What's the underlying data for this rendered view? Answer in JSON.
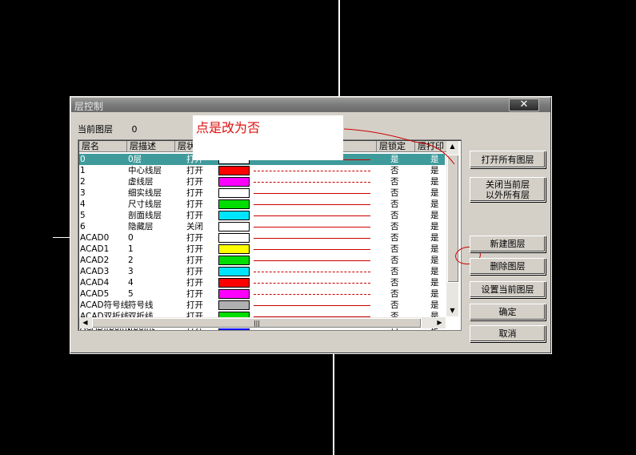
{
  "dialog": {
    "title": "层控制",
    "close_label": "✕",
    "current_layer_label": "当前图层",
    "current_layer_value": "0",
    "annotation": "点是改为否"
  },
  "columns": [
    "层名",
    "层描述",
    "层状",
    "层锁定",
    "层打印"
  ],
  "rows": [
    {
      "name": "0",
      "desc": "0层",
      "state": "打开",
      "color": "#ffffff",
      "line": "solid",
      "locked": "是",
      "print": "是",
      "selected": true
    },
    {
      "name": "1",
      "desc": "中心线层",
      "state": "打开",
      "color": "#ff0000",
      "line": "dashdot",
      "locked": "否",
      "print": "是"
    },
    {
      "name": "2",
      "desc": "虚线层",
      "state": "打开",
      "color": "#ff00ff",
      "line": "dash",
      "locked": "否",
      "print": "是"
    },
    {
      "name": "3",
      "desc": "细实线层",
      "state": "打开",
      "color": "#ffffff",
      "line": "solid",
      "locked": "否",
      "print": "是"
    },
    {
      "name": "4",
      "desc": "尺寸线层",
      "state": "打开",
      "color": "#00dd00",
      "line": "solid",
      "locked": "否",
      "print": "是"
    },
    {
      "name": "5",
      "desc": "剖面线层",
      "state": "打开",
      "color": "#00e5ff",
      "line": "solid",
      "locked": "否",
      "print": "是"
    },
    {
      "name": "6",
      "desc": "隐藏层",
      "state": "关闭",
      "color": "#ffffff",
      "line": "solid",
      "locked": "否",
      "print": "是"
    },
    {
      "name": "ACAD0",
      "desc": "0",
      "state": "打开",
      "color": "#ffffff",
      "line": "solid",
      "locked": "否",
      "print": "是"
    },
    {
      "name": "ACAD1",
      "desc": "1",
      "state": "打开",
      "color": "#ffff00",
      "line": "solid",
      "locked": "否",
      "print": "是"
    },
    {
      "name": "ACAD2",
      "desc": "2",
      "state": "打开",
      "color": "#00dd00",
      "line": "solid",
      "locked": "否",
      "print": "是"
    },
    {
      "name": "ACAD3",
      "desc": "3",
      "state": "打开",
      "color": "#00e5ff",
      "line": "dash",
      "locked": "否",
      "print": "是"
    },
    {
      "name": "ACAD4",
      "desc": "4",
      "state": "打开",
      "color": "#ff0000",
      "line": "dashdot",
      "locked": "否",
      "print": "是"
    },
    {
      "name": "ACAD5",
      "desc": "5",
      "state": "打开",
      "color": "#ff00ff",
      "line": "dashdot",
      "locked": "否",
      "print": "是"
    },
    {
      "name": "ACAD符号线",
      "desc": "符号线",
      "state": "打开",
      "color": "#b0b0b0",
      "line": "solid",
      "locked": "否",
      "print": "是"
    },
    {
      "name": "ACAD双折线",
      "desc": "双折线",
      "state": "打开",
      "color": "#00dd00",
      "line": "solid",
      "locked": "否",
      "print": "是"
    },
    {
      "name": "ACADifpoint",
      "desc": "ifpoint",
      "state": "打开",
      "color": "#0000ee",
      "line": "solid",
      "locked": "否",
      "print": "是"
    }
  ],
  "buttons": {
    "open_all": "打开所有图层",
    "close_others": "关闭当前层\n以外所有层",
    "new_layer": "新建图层",
    "delete_layer": "删除图层",
    "set_current": "设置当前图层",
    "ok": "确定",
    "cancel": "取消"
  },
  "scroll": {
    "grip": "|||"
  }
}
